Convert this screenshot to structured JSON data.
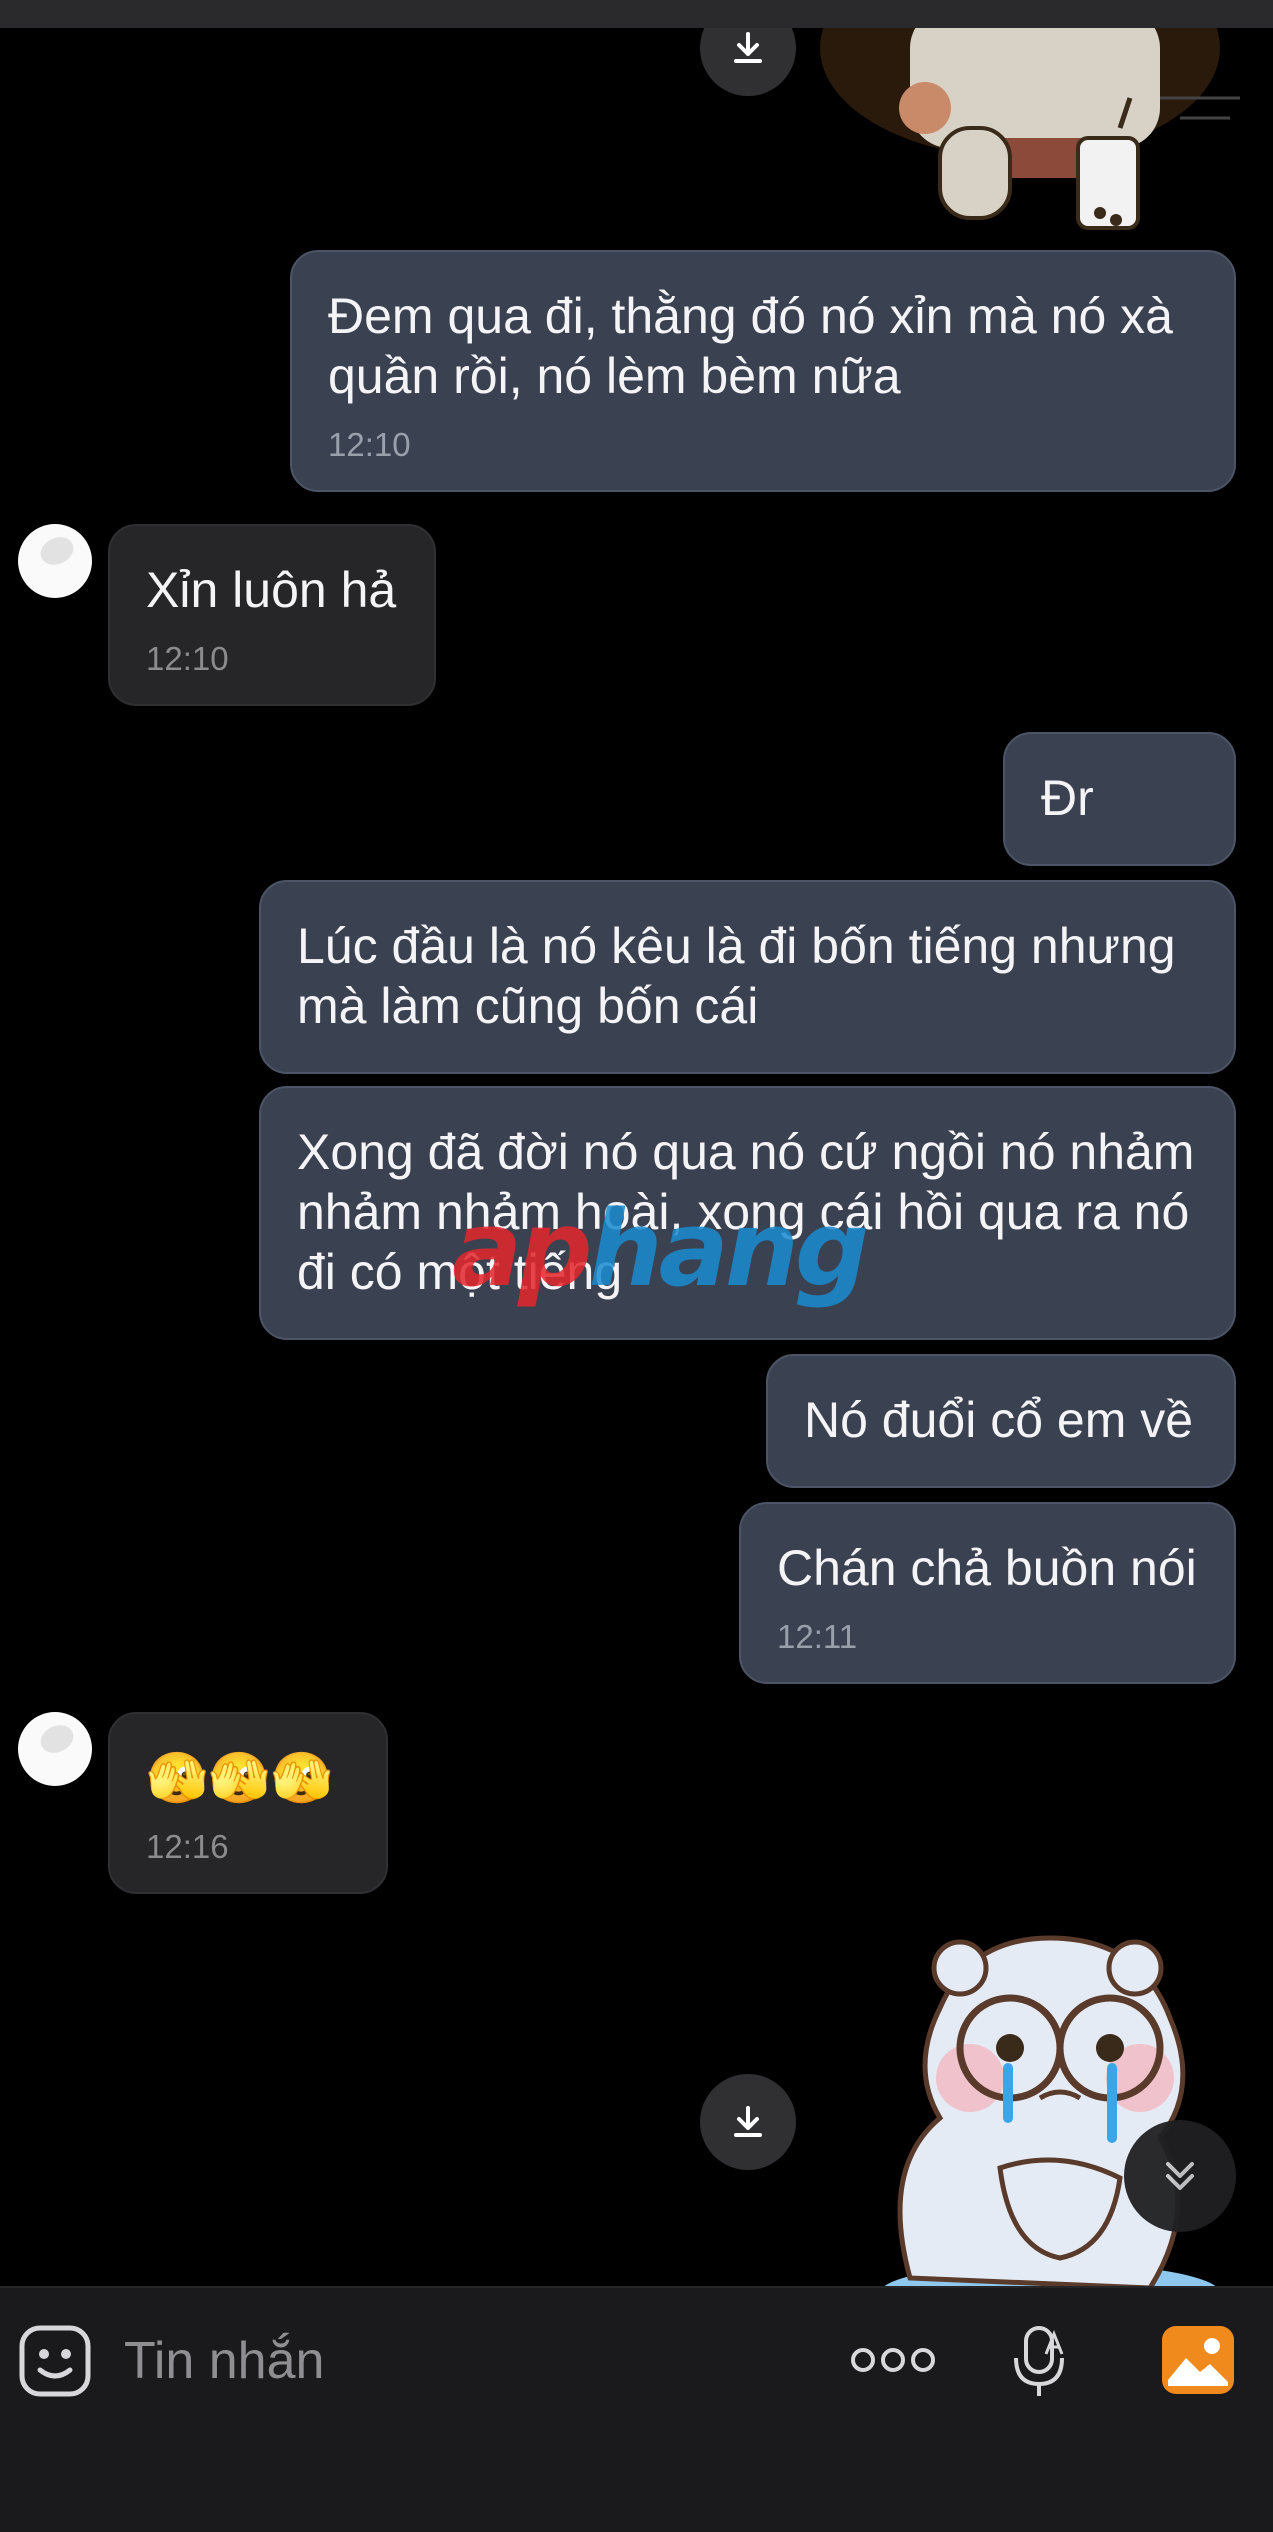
{
  "conversation": {
    "messages": [
      {
        "text": "Đem qua đi, thằng đó nó xỉn mà nó xà quần rồi, nó lèm bèm nữa",
        "time": "12:10"
      },
      {
        "text": "Xỉn luôn hả",
        "time": "12:10"
      },
      {
        "text": "Đr"
      },
      {
        "text": "Lúc đầu là nó kêu là đi bốn tiếng nhưng mà làm cũng bốn cái"
      },
      {
        "text": "Xong đã đời nó qua nó cứ ngồi nó nhảm nhảm nhảm hoài, xong cái hồi qua ra nó đi có một tiếng"
      },
      {
        "text": "Nó đuổi cổ em về"
      },
      {
        "text": "Chán chả buồn nói",
        "time": "12:11"
      },
      {
        "text": "🫣🫣🫣",
        "time": "12:16"
      }
    ]
  },
  "watermark": {
    "part1": "ap",
    "part2": "hang"
  },
  "composer": {
    "placeholder": "Tin nhắn"
  },
  "icons": {
    "download": "download-icon",
    "scroll_down": "chevron-double-down-icon",
    "emoji": "emoji-icon",
    "more": "more-icon",
    "mic": "mic-icon",
    "photo": "image-icon"
  },
  "colors": {
    "outgoing_bubble": "#3a4150",
    "incoming_bubble": "#262628",
    "photo_button": "#f08a1c"
  }
}
